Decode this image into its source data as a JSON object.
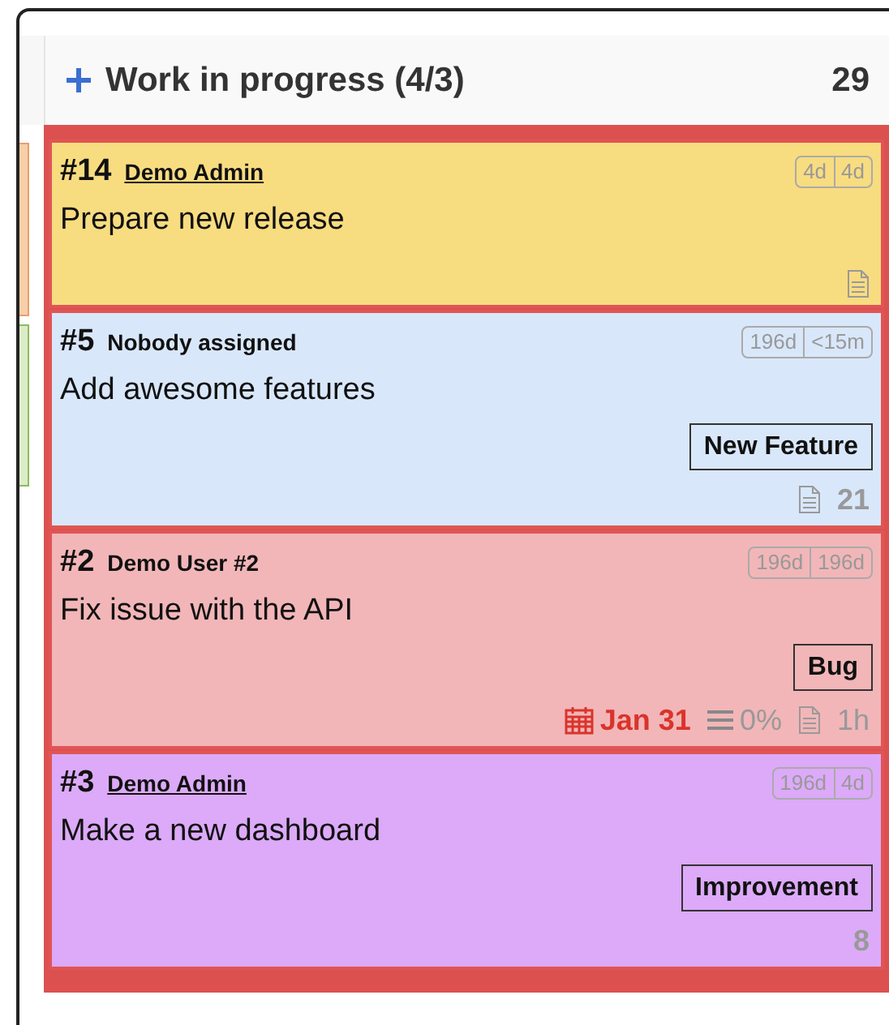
{
  "column": {
    "title": "Work in progress (4/3)",
    "count": "29"
  },
  "cards": [
    {
      "number": "#14",
      "assignee": "Demo Admin",
      "linked": true,
      "color": "#f8dc80",
      "title": "Prepare new release",
      "times": [
        "4d",
        "4d"
      ],
      "footer": [
        {
          "kind": "description"
        }
      ]
    },
    {
      "number": "#5",
      "assignee": "Nobody assigned",
      "linked": false,
      "color": "#d9e7fb",
      "title": "Add awesome features",
      "times": [
        "196d",
        "<15m"
      ],
      "tag": "New Feature",
      "footer": [
        {
          "kind": "description"
        },
        {
          "kind": "points",
          "text": "21"
        }
      ]
    },
    {
      "number": "#2",
      "assignee": "Demo User #2",
      "linked": false,
      "color": "#f2b6b8",
      "title": "Fix issue with the API",
      "times": [
        "196d",
        "196d"
      ],
      "tag": "Bug",
      "footer": [
        {
          "kind": "due",
          "text": "Jan 31"
        },
        {
          "kind": "checklist",
          "text": "0%"
        },
        {
          "kind": "description"
        },
        {
          "kind": "estimate",
          "text": "1h"
        }
      ]
    },
    {
      "number": "#3",
      "assignee": "Demo Admin",
      "linked": true,
      "color": "#dcaaf8",
      "title": "Make a new dashboard",
      "times": [
        "196d",
        "4d"
      ],
      "tag": "Improvement",
      "footer": [
        {
          "kind": "points",
          "text": "8"
        }
      ]
    }
  ]
}
